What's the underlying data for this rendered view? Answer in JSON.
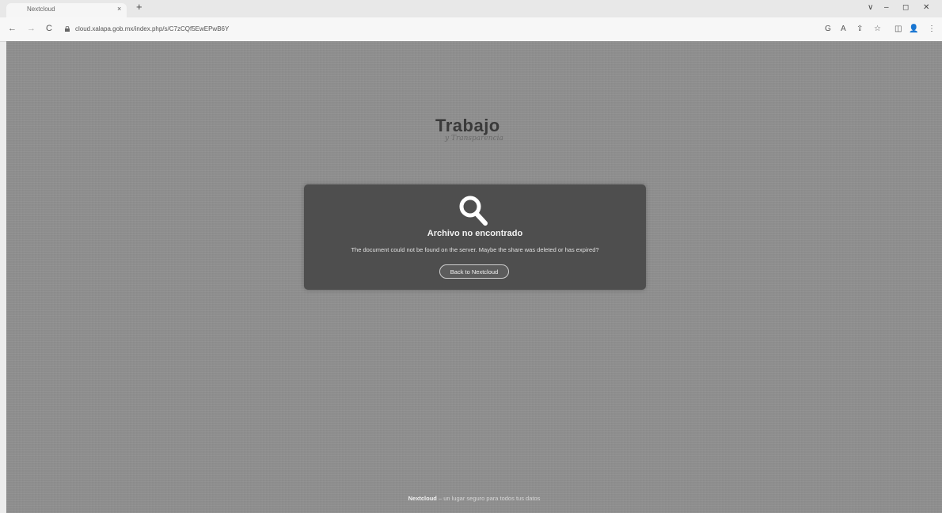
{
  "browser": {
    "tab_title": "Nextcloud",
    "tab_close": "×",
    "new_tab": "+",
    "url": "cloud.xalapa.gob.mx/index.php/s/C7zCQf5EwEPwB6Y",
    "nav": {
      "back": "←",
      "forward": "→",
      "reload": "C"
    },
    "window_controls": [
      "∨",
      "–",
      "◻",
      "✕"
    ],
    "toolbar_icons": [
      "G",
      "A",
      "⇪",
      "☆",
      "◫",
      "👤",
      "⋮"
    ]
  },
  "page": {
    "logo_title": "Trabajo",
    "logo_subtitle": "y Transparencia",
    "card": {
      "icon": "search-icon",
      "title": "Archivo no encontrado",
      "message": "The document could not be found on the server. Maybe the share was deleted or has expired?",
      "button_label": "Back to Nextcloud"
    },
    "footer_brand": "Nextcloud",
    "footer_text": " – un lugar seguro para todos tus datos"
  },
  "colors": {
    "background": "#8e8e8e",
    "card": "#4e4e4e",
    "text": "#f2f2f2"
  }
}
